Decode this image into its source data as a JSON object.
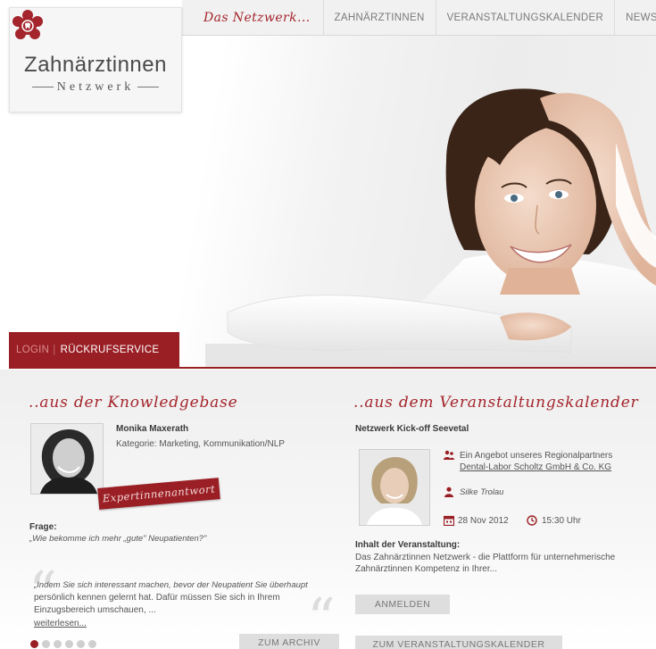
{
  "nav": {
    "items": [
      "Das Netzwerk...",
      "ZAHNÄRZTINNEN",
      "VERANSTALTUNGSKALENDER",
      "NEWS"
    ]
  },
  "logo": {
    "name": "Zahnärztinnen",
    "sub": "Netzwerk"
  },
  "login_bar": {
    "login": "LOGIN",
    "separator": "|",
    "callback": "RÜCKRUFSERVICE"
  },
  "knowledge": {
    "title": "..aus der Knowledgebase",
    "expert_name": "Monika Maxerath",
    "category": "Kategorie: Marketing, Kommunikation/NLP",
    "badge": "Expertinnenantwort",
    "question_label": "Frage:",
    "question": "„Wie bekomme ich mehr „gute\" Neupatienten?\"",
    "answer_line1": "„Indem Sie sich interessant machen, bevor der Neupatient Sie überhaupt",
    "answer_line2": "persönlich kennen gelernt hat. Dafür müssen Sie sich in Ihrem",
    "answer_line3": "Einzugsbereich umschauen, ...",
    "read_more": "weiterlesen...",
    "archive_button": "ZUM ARCHIV",
    "slider_total": 6,
    "slider_active": 1
  },
  "events": {
    "title": "..aus dem Veranstaltungskalender",
    "event_name": "Netzwerk Kick-off Seevetal",
    "offer_line1": "Ein Angebot unseres Regionalpartners",
    "offer_partner": "Dental-Labor Scholtz GmbH & Co. KG",
    "speaker": "Silke Trolau",
    "date": "28 Nov 2012",
    "time": "15:30 Uhr",
    "content_label": "Inhalt der Veranstaltung:",
    "content_line1": "Das Zahnärztinnen Netzwerk - die Plattform für unternehmerische",
    "content_line2": "Zahnärztinnen Kompetenz in Ihrer...",
    "register_button": "ANMELDEN",
    "calendar_button": "ZUM VERANSTALTUNGSKALENDER"
  },
  "colors": {
    "brand_red": "#9a1f25",
    "script_red": "#a4252c",
    "nav_bg": "#f1f1f1",
    "button_bg": "#dedede"
  }
}
